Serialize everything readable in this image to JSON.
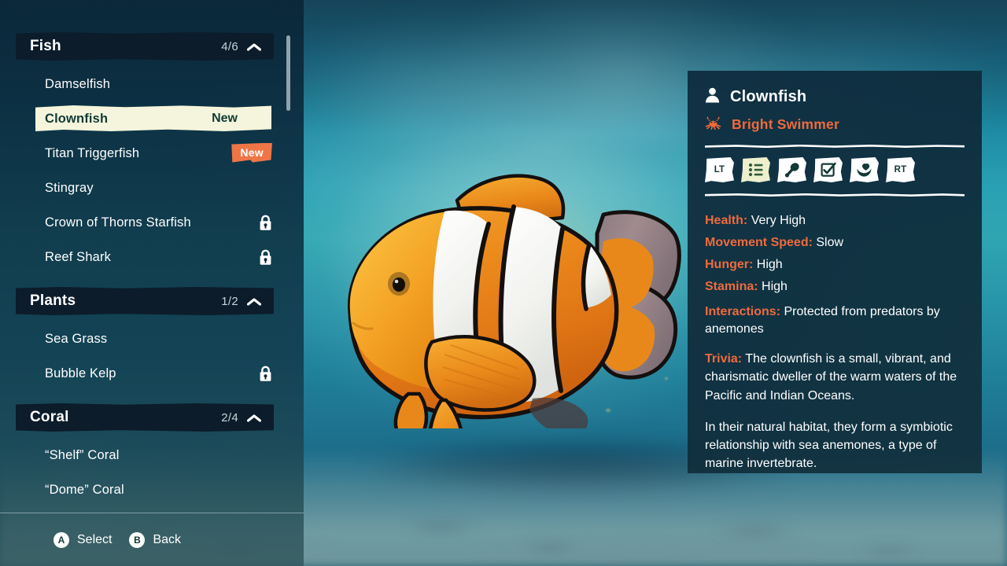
{
  "sidebar": {
    "scroll_position": "near-top",
    "groups": [
      {
        "title": "Fish",
        "count": "4/6",
        "collapse_icon": "chevron-up-icon",
        "items": [
          {
            "label": "Damselfish",
            "state": "unlocked",
            "badge": ""
          },
          {
            "label": "Clownfish",
            "state": "selected",
            "badge": "New"
          },
          {
            "label": "Titan Triggerfish",
            "state": "unlocked",
            "badge": "New"
          },
          {
            "label": "Stingray",
            "state": "unlocked",
            "badge": ""
          },
          {
            "label": "Crown of Thorns Starfish",
            "state": "locked",
            "badge": ""
          },
          {
            "label": "Reef Shark",
            "state": "locked",
            "badge": ""
          }
        ]
      },
      {
        "title": "Plants",
        "count": "1/2",
        "collapse_icon": "chevron-up-icon",
        "items": [
          {
            "label": "Sea Grass",
            "state": "unlocked",
            "badge": ""
          },
          {
            "label": "Bubble Kelp",
            "state": "locked",
            "badge": ""
          }
        ]
      },
      {
        "title": "Coral",
        "count": "2/4",
        "collapse_icon": "chevron-up-icon",
        "items": [
          {
            "label": "“Shelf” Coral",
            "state": "unlocked",
            "badge": ""
          },
          {
            "label": "“Dome” Coral",
            "state": "unlocked",
            "badge": ""
          }
        ]
      }
    ]
  },
  "footer": {
    "hints": [
      {
        "button": "A",
        "label": "Select"
      },
      {
        "button": "B",
        "label": "Back"
      }
    ]
  },
  "info_panel": {
    "species_icon": "person-icon",
    "species_name": "Clownfish",
    "trait_icon": "crab-icon",
    "trait_name": "Bright Swimmer",
    "tabs": [
      {
        "id": "lt-bumper",
        "icon": "lt-trigger-icon",
        "text": "LT",
        "active": false
      },
      {
        "id": "stats",
        "icon": "list-icon",
        "text": "",
        "active": true
      },
      {
        "id": "food",
        "icon": "drumstick-icon",
        "text": "",
        "active": false
      },
      {
        "id": "tasks",
        "icon": "checkbox-icon",
        "text": "",
        "active": false
      },
      {
        "id": "care",
        "icon": "heart-hand-icon",
        "text": "",
        "active": false
      },
      {
        "id": "rt-bumper",
        "icon": "rt-trigger-icon",
        "text": "RT",
        "active": false
      }
    ],
    "stats": [
      {
        "key": "Health:",
        "value": "Very High"
      },
      {
        "key": "Movement Speed:",
        "value": "Slow"
      },
      {
        "key": "Hunger:",
        "value": "High"
      },
      {
        "key": "Stamina:",
        "value": "High"
      },
      {
        "key": "Interactions:",
        "value": "Protected from predators by anemones"
      }
    ],
    "paragraphs": [
      {
        "key": "Trivia:",
        "text": "The clownfish is a small, vibrant, and charismatic dweller of the warm waters of the Pacific and Indian Oceans."
      },
      {
        "key": "",
        "text": "In their natural habitat, they form a symbiotic relationship with sea anemones, a type of marine invertebrate."
      }
    ]
  },
  "scene": {
    "creature": "clownfish",
    "description": "3D clownfish model floating over an underwater reef floor"
  },
  "colors": {
    "accent_orange": "#ef6a3d",
    "badge_orange": "#ef7547",
    "highlight_cream": "#f4f5dc",
    "highlight_text": "#123a36",
    "panel_navy": "#0d2c3e",
    "header_navy": "#0c1c2a",
    "text_white": "#ffffff",
    "count_grey": "#c6d3da"
  }
}
